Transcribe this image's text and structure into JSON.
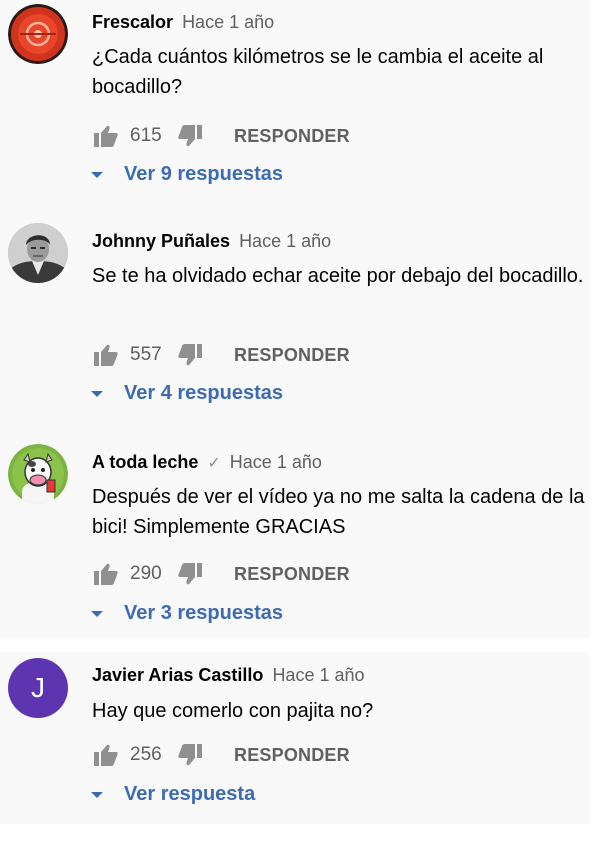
{
  "comments": [
    {
      "author": "Frescalor",
      "time": "Hace 1 año",
      "verified": false,
      "text": "¿Cada cuántos kilómetros se le cambia el aceite al bocadillo?",
      "likes": "615",
      "reply_label": "RESPONDER",
      "replies_label": "Ver 9 respuestas",
      "avatar_icon": "red-circle-logo-avatar"
    },
    {
      "author": "Johnny Puñales",
      "time": "Hace 1 año",
      "verified": false,
      "text": "Se te ha olvidado echar aceite por debajo del bocadillo.",
      "likes": "557",
      "reply_label": "RESPONDER",
      "replies_label": "Ver 4 respuestas",
      "avatar_icon": "grayscale-portrait-avatar"
    },
    {
      "author": "A toda leche",
      "time": "Hace 1 año",
      "verified": true,
      "verified_mark": "✓",
      "text": "Después de ver el vídeo ya no me salta la cadena de la bici!  Simplemente GRACIAS",
      "likes": "290",
      "reply_label": "RESPONDER",
      "replies_label": "Ver 3 respuestas",
      "avatar_icon": "cartoon-cow-avatar"
    },
    {
      "author": "Javier Arias Castillo",
      "time": "Hace 1 año",
      "verified": false,
      "text": "Hay que comerlo con pajita no?",
      "likes": "256",
      "reply_label": "RESPONDER",
      "replies_label": "Ver respuesta",
      "avatar_letter": "J",
      "avatar_icon": "letter-avatar"
    }
  ],
  "colors": {
    "panel_bg": "#f9f9f9",
    "link_blue": "#3d6bb3",
    "meta_gray": "#606060",
    "avatar_purple": "#5e35b1"
  }
}
